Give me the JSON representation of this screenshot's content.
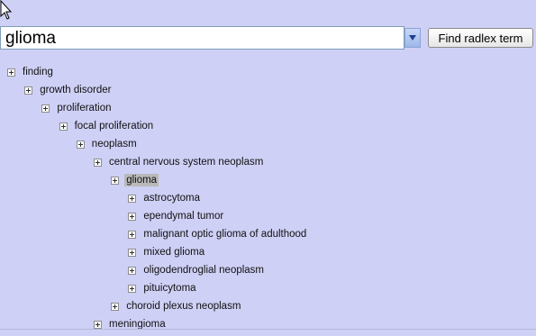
{
  "search": {
    "value": "glioma",
    "button_label": "Find radlex term"
  },
  "tree": [
    {
      "label": "finding",
      "level": 0
    },
    {
      "label": "growth disorder",
      "level": 1
    },
    {
      "label": "proliferation",
      "level": 2
    },
    {
      "label": "focal proliferation",
      "level": 3
    },
    {
      "label": "neoplasm",
      "level": 4
    },
    {
      "label": "central nervous system neoplasm",
      "level": 5
    },
    {
      "label": "glioma",
      "level": 6,
      "selected": true
    },
    {
      "label": "astrocytoma",
      "level": 7
    },
    {
      "label": "ependymal tumor",
      "level": 7
    },
    {
      "label": "malignant optic glioma of adulthood",
      "level": 7
    },
    {
      "label": "mixed glioma",
      "level": 7
    },
    {
      "label": "oligodendroglial neoplasm",
      "level": 7
    },
    {
      "label": "pituicytoma",
      "level": 7
    },
    {
      "label": "choroid plexus neoplasm",
      "level": 6
    },
    {
      "label": "meningioma",
      "level": 5
    }
  ],
  "colors": {
    "background": "#cfd0f6",
    "selected": "#b9b9b9",
    "accent": "#2f5fc4"
  },
  "icons": {
    "cursor": "arrow-cursor-icon",
    "dropdown": "triangle-down-icon",
    "expander": "plus-box-icon"
  }
}
